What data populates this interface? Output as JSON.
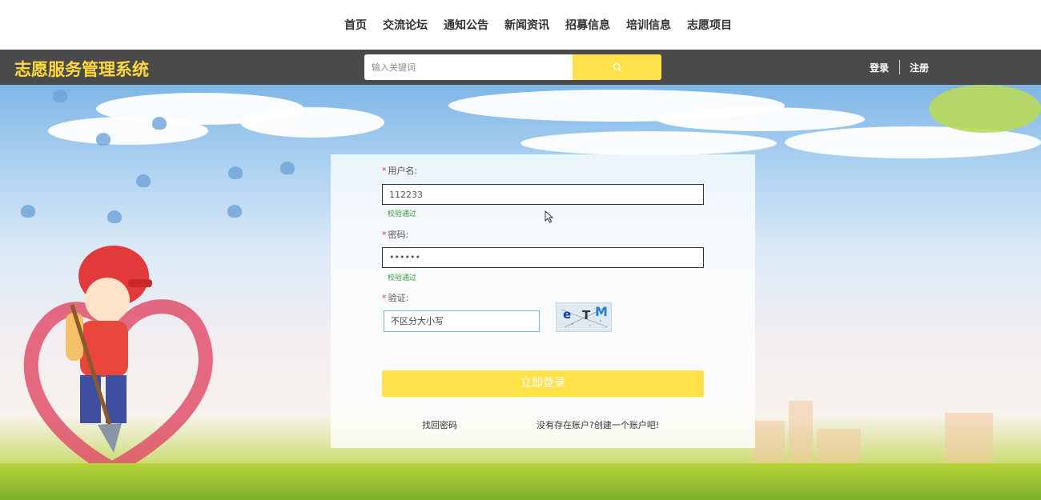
{
  "nav": {
    "items": [
      "首页",
      "交流论坛",
      "通知公告",
      "新闻资讯",
      "招募信息",
      "培训信息",
      "志愿项目"
    ]
  },
  "header": {
    "brand": "志愿服务管理系统",
    "search_placeholder": "输入关键词",
    "search_icon": "search-icon",
    "login": "登录",
    "register": "注册"
  },
  "form": {
    "username_label": "用户名:",
    "username_value": "112233",
    "username_hint": "校验通过",
    "password_label": "密码:",
    "password_value": "••••••",
    "password_hint": "校验通过",
    "captcha_label": "验证:",
    "captcha_value": "不区分大小写",
    "captcha_text": "eTM",
    "submit": "立即登录",
    "forgot": "找回密码",
    "create_account": "没有存在账户?创建一个账户吧!"
  },
  "colors": {
    "accent": "#ffe14a",
    "brand": "#ffd93b",
    "header_bg": "#4a4a4a",
    "hint": "#3a9a3a",
    "required": "#e4393c"
  }
}
